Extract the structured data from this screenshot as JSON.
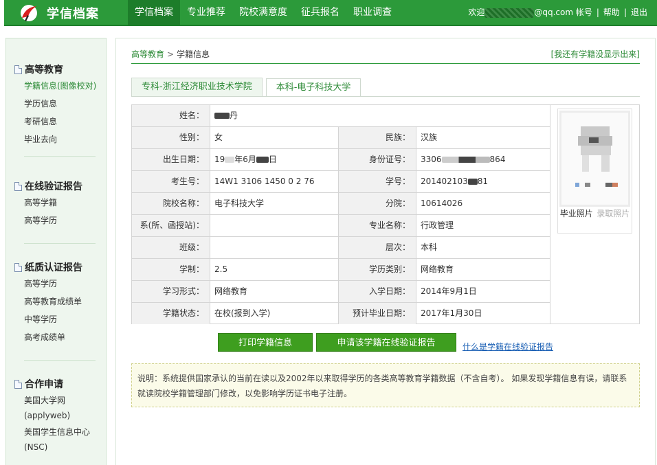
{
  "header": {
    "logo_text": "学信档案",
    "nav": [
      "学信档案",
      "专业推荐",
      "院校满意度",
      "征兵报名",
      "职业调查"
    ],
    "welcome": "欢迎",
    "email_suffix": "@qq.com",
    "account": "帐号",
    "help": "帮助",
    "logout": "退出"
  },
  "sidebar": {
    "groups": [
      {
        "title": "高等教育",
        "items": [
          "学籍信息(图像校对)",
          "学历信息",
          "考研信息",
          "毕业去向"
        ]
      },
      {
        "title": "在线验证报告",
        "items": [
          "高等学籍",
          "高等学历"
        ]
      },
      {
        "title": "纸质认证报告",
        "items": [
          "高等学历",
          "高等教育成绩单",
          "中等学历",
          "高考成绩单"
        ]
      },
      {
        "title": "合作申请",
        "items": [
          "美国大学网",
          "(applyweb)",
          "美国学生信息中心",
          "(NSC)"
        ]
      }
    ]
  },
  "breadcrumb": {
    "root": "高等教育",
    "sep": ">",
    "current": "学籍信息"
  },
  "not_shown_link": "[我还有学籍没显示出来]",
  "tabs": [
    "专科-浙江经济职业技术学院",
    "本科-电子科技大学"
  ],
  "record": {
    "name_label": "姓名：",
    "name_value": "丹",
    "gender_label": "性别：",
    "gender_value": "女",
    "ethnicity_label": "民族：",
    "ethnicity_value": "汉族",
    "birth_label": "出生日期：",
    "birth_p1": "19",
    "birth_p2": "年6月",
    "birth_p3": "日",
    "id_label": "身份证号：",
    "id_p1": "3306",
    "id_p2": "864",
    "exam_label": "考生号：",
    "exam_value": "14W1 3106 1450 0 2 76",
    "student_no_label": "学号：",
    "student_no_p1": "201402103",
    "student_no_p2": "81",
    "school_label": "院校名称：",
    "school_value": "电子科技大学",
    "branch_label": "分院：",
    "branch_value": "10614026",
    "dept_label": "系(所、函授站)：",
    "dept_value": "",
    "major_label": "专业名称：",
    "major_value": "行政管理",
    "class_label": "班级：",
    "class_value": "",
    "level_label": "层次：",
    "level_value": "本科",
    "duration_label": "学制：",
    "duration_value": "2.5",
    "category_label": "学历类别：",
    "category_value": "网络教育",
    "form_label": "学习形式：",
    "form_value": "网络教育",
    "enroll_label": "入学日期：",
    "enroll_value": "2014年9月1日",
    "status_label": "学籍状态：",
    "status_value": "在校(报到入学)",
    "grad_label": "预计毕业日期：",
    "grad_value": "2017年1月30日",
    "photo_grad": "毕业照片",
    "photo_enroll": "录取照片"
  },
  "buttons": {
    "print": "打印学籍信息",
    "apply": "申请该学籍在线验证报告",
    "help_link": "什么是学籍在线验证报告"
  },
  "notice": "说明：系统提供国家承认的当前在读以及2002年以来取得学历的各类高等教育学籍数据（不含自考）。 如果发现学籍信息有误，请联系就读院校学籍管理部门修改，以免影响学历证书电子注册。",
  "colors": {
    "brand_green": "#2c9a3a",
    "link_green": "#2c8a36",
    "button_green": "#3e9e1f",
    "link_blue": "#1a5fb4"
  }
}
